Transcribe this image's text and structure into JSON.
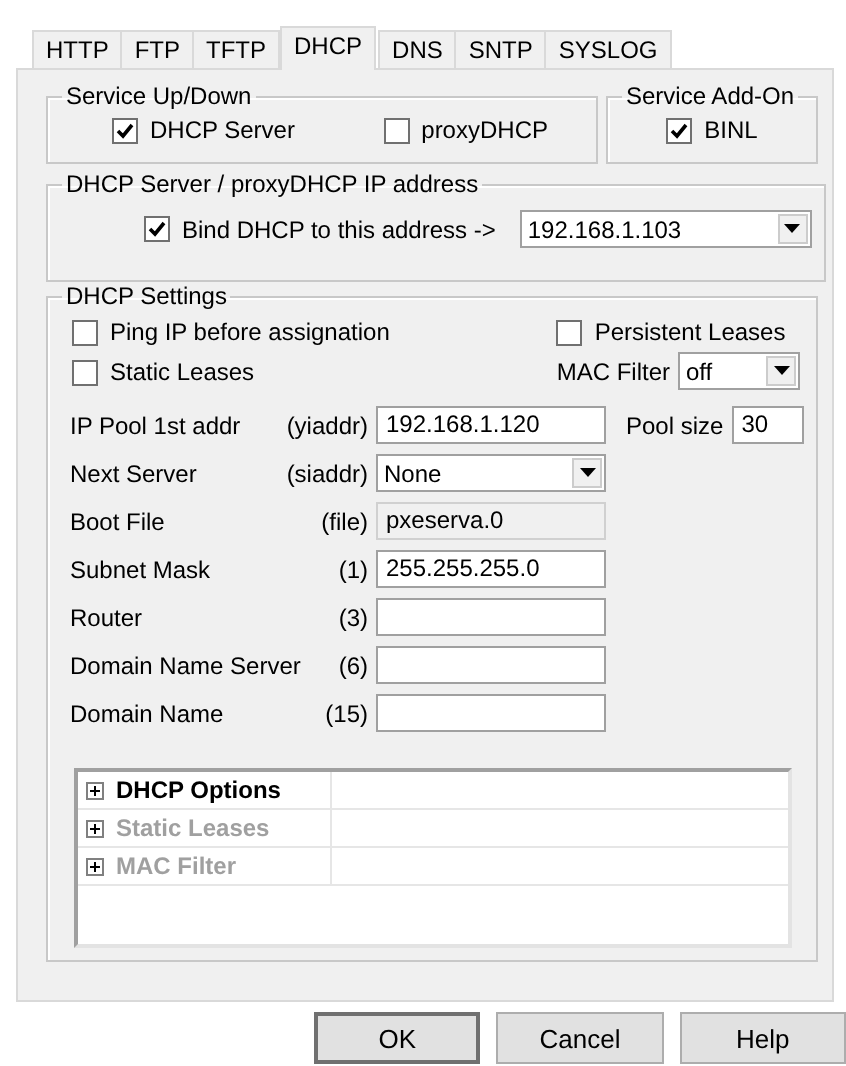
{
  "tabs": [
    {
      "label": "HTTP",
      "selected": false
    },
    {
      "label": "FTP",
      "selected": false
    },
    {
      "label": "TFTP",
      "selected": false
    },
    {
      "label": "DHCP",
      "selected": true
    },
    {
      "label": "DNS",
      "selected": false
    },
    {
      "label": "SNTP",
      "selected": false
    },
    {
      "label": "SYSLOG",
      "selected": false
    }
  ],
  "service_up_down": {
    "title": "Service Up/Down",
    "checkboxes": [
      {
        "label": "DHCP Server",
        "checked": true
      },
      {
        "label": "proxyDHCP",
        "checked": false
      }
    ]
  },
  "service_add_on": {
    "title": "Service Add-On",
    "checkboxes": [
      {
        "label": "BINL",
        "checked": true
      }
    ]
  },
  "ip_address": {
    "title": "DHCP Server / proxyDHCP IP address",
    "bind": {
      "label": "Bind DHCP to this address  ->",
      "checked": true
    },
    "address": "192.168.1.103"
  },
  "settings": {
    "title": "DHCP Settings",
    "options": [
      {
        "label": "Ping IP before assignation",
        "checked": false
      },
      {
        "label": "Persistent Leases",
        "checked": false
      },
      {
        "label": "Static Leases",
        "checked": false
      }
    ],
    "mac_filter": {
      "label": "MAC Filter",
      "value": "off"
    },
    "fields": [
      {
        "label": "IP Pool 1st addr",
        "code": "(yiaddr)",
        "kind": "text",
        "value": "192.168.1.120"
      },
      {
        "label": "Next Server",
        "code": "(siaddr)",
        "kind": "combo",
        "value": "None"
      },
      {
        "label": "Boot File",
        "code": "(file)",
        "kind": "readonly",
        "value": "pxeserva.0"
      },
      {
        "label": "Subnet Mask",
        "code": "(1)",
        "kind": "text",
        "value": "255.255.255.0"
      },
      {
        "label": "Router",
        "code": "(3)",
        "kind": "text"
      },
      {
        "label": "Domain Name Server",
        "code": "(6)",
        "kind": "text"
      },
      {
        "label": "Domain Name",
        "code": "(15)",
        "kind": "text"
      }
    ],
    "pool_size": {
      "label": "Pool size",
      "value": "30"
    },
    "tree": [
      {
        "label": "DHCP Options",
        "disabled": false
      },
      {
        "label": "Static Leases",
        "disabled": true
      },
      {
        "label": "MAC Filter",
        "disabled": true
      }
    ]
  },
  "buttons": [
    {
      "label": "OK",
      "default": true
    },
    {
      "label": "Cancel",
      "default": false
    },
    {
      "label": "Help",
      "default": false
    }
  ]
}
